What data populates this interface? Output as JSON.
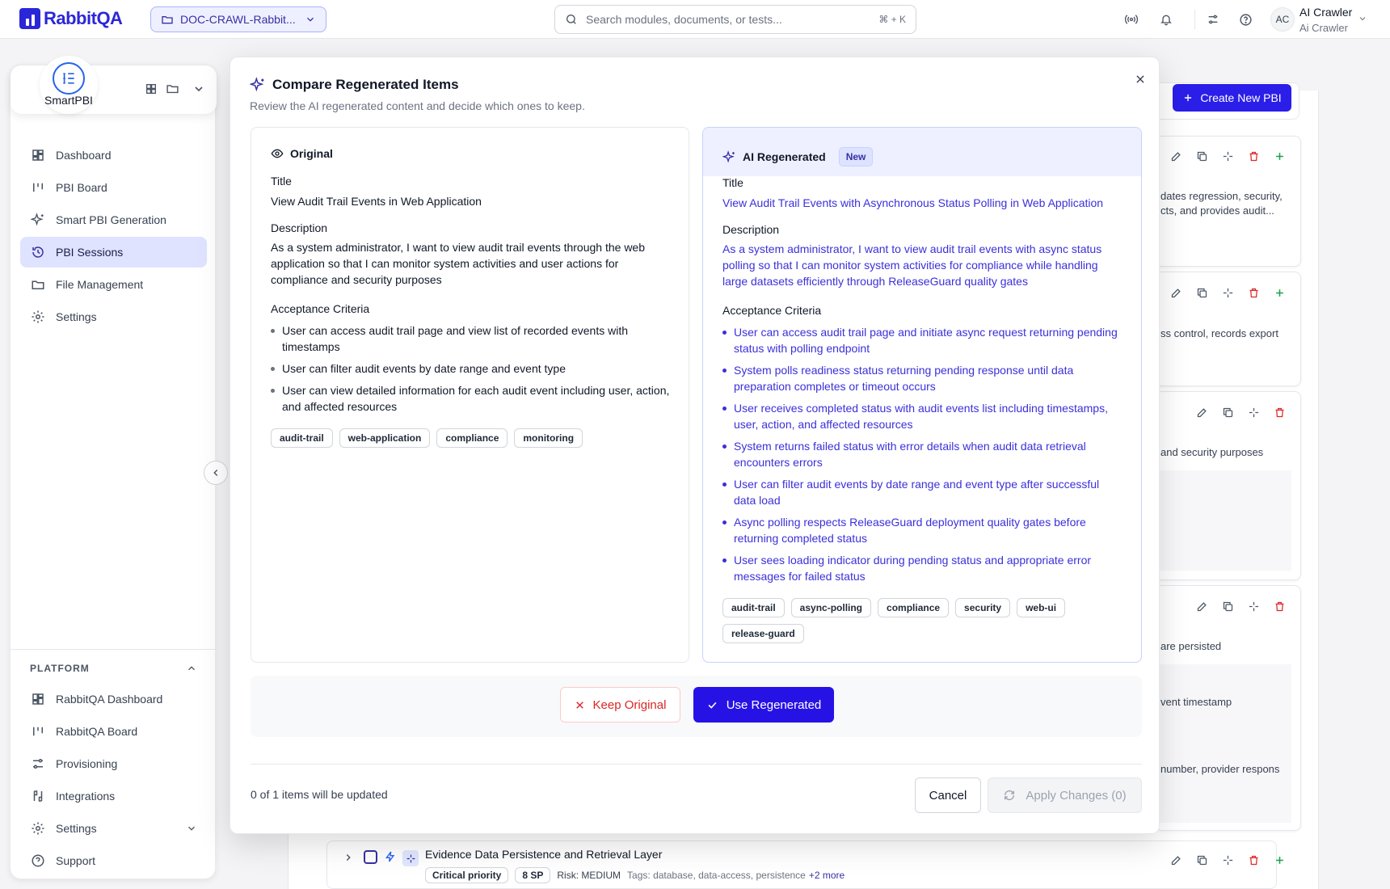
{
  "brand": {
    "name": "RabbitQA",
    "color": "#2b27d8"
  },
  "project": {
    "name": "DOC-CRAWL-Rabbit..."
  },
  "search": {
    "placeholder": "Search modules, documents, or tests...",
    "shortcut": "⌘ + K"
  },
  "user": {
    "initials": "AC",
    "name": "AI Crawler",
    "subtitle": "Ai Crawler"
  },
  "sidebar": {
    "app_name": "SmartPBI",
    "items": [
      {
        "label": "Dashboard",
        "icon": "dashboard-icon"
      },
      {
        "label": "PBI Board",
        "icon": "board-icon"
      },
      {
        "label": "Smart PBI Generation",
        "icon": "sparkle-icon"
      },
      {
        "label": "PBI Sessions",
        "icon": "history-icon",
        "active": true
      },
      {
        "label": "File Management",
        "icon": "folder-icon"
      },
      {
        "label": "Settings",
        "icon": "gear-icon"
      }
    ],
    "platform_title": "PLATFORM",
    "platform_items": [
      {
        "label": "RabbitQA Dashboard",
        "icon": "dashboard-icon"
      },
      {
        "label": "RabbitQA Board",
        "icon": "board-icon"
      },
      {
        "label": "Provisioning",
        "icon": "sliders-icon"
      },
      {
        "label": "Integrations",
        "icon": "integrations-icon"
      },
      {
        "label": "Settings",
        "icon": "gear-icon"
      },
      {
        "label": "Support",
        "icon": "help-icon"
      }
    ]
  },
  "background": {
    "create_button": "Create New PBI",
    "snippets": [
      "dates regression, security,",
      "cts, and provides audit...",
      "ss control, records export",
      "and security purposes",
      "are persisted",
      "vent timestamp",
      "number, provider respons"
    ],
    "row": {
      "title": "Evidence Data Persistence and Retrieval Layer",
      "priority": "Critical priority",
      "points": "8 SP",
      "risk": "Risk: MEDIUM",
      "tags": "Tags: database, data-access, persistence",
      "more": "+2 more"
    }
  },
  "modal": {
    "title": "Compare Regenerated Items",
    "subtitle": "Review the AI regenerated content and decide which ones to keep.",
    "labels": {
      "title": "Title",
      "description": "Description",
      "criteria": "Acceptance Criteria"
    },
    "original": {
      "heading": "Original",
      "title": "View Audit Trail Events in Web Application",
      "description": "As a system administrator, I want to view audit trail events through the web application so that I can monitor system activities and user actions for compliance and security purposes",
      "criteria": [
        "User can access audit trail page and view list of recorded events with timestamps",
        "User can filter audit events by date range and event type",
        "User can view detailed information for each audit event including user, action, and affected resources"
      ],
      "tags": [
        "audit-trail",
        "web-application",
        "compliance",
        "monitoring"
      ]
    },
    "regenerated": {
      "heading": "AI Regenerated",
      "badge": "New",
      "title": "View Audit Trail Events with Asynchronous Status Polling in Web Application",
      "description": "As a system administrator, I want to view audit trail events with async status polling so that I can monitor system activities for compliance while handling large datasets efficiently through ReleaseGuard quality gates",
      "criteria": [
        "User can access audit trail page and initiate async request returning pending status with polling endpoint",
        "System polls readiness status returning pending response until data preparation completes or timeout occurs",
        "User receives completed status with audit events list including timestamps, user, action, and affected resources",
        "System returns failed status with error details when audit data retrieval encounters errors",
        "User can filter audit events by date range and event type after successful data load",
        "Async polling respects ReleaseGuard deployment quality gates before returning completed status",
        "User sees loading indicator during pending status and appropriate error messages for failed status"
      ],
      "tags": [
        "audit-trail",
        "async-polling",
        "compliance",
        "security",
        "web-ui",
        "release-guard"
      ]
    },
    "keep_label": "Keep Original",
    "use_label": "Use Regenerated",
    "status": "0 of 1 items will be updated",
    "cancel_label": "Cancel",
    "apply_label": "Apply Changes (0)"
  }
}
